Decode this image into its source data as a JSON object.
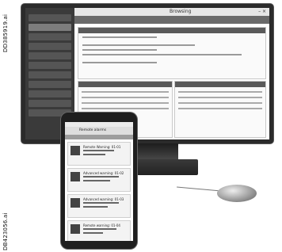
{
  "labels": {
    "top": "DD385919.ai",
    "bottom": "DB423056.ai"
  },
  "monitor": {
    "window_title": "Browsing",
    "window_controls": "– ×"
  },
  "phone": {
    "header": "Remote alarms",
    "cards": [
      "Remote Warning: 01-01",
      "Advanced warning: 01-02",
      "Advanced warning: 01-03",
      "Remote warning: 01-04"
    ]
  }
}
